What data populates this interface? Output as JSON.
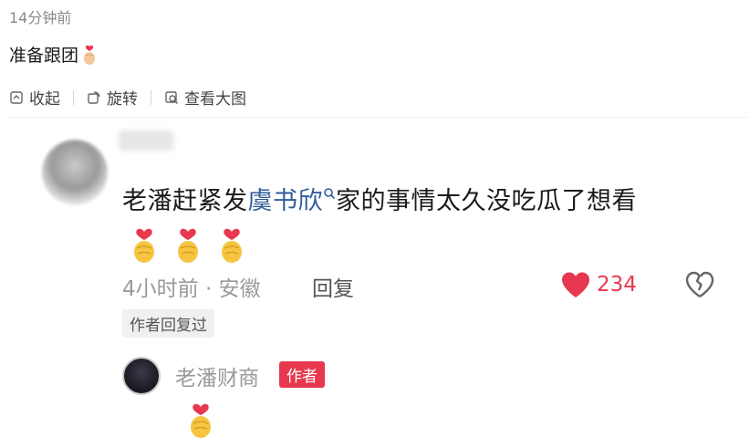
{
  "post": {
    "time": "14分钟前",
    "text": "准备跟团",
    "emoji_icon": "hand-heart-small-icon"
  },
  "actions": [
    {
      "label": "收起",
      "icon": "collapse-icon"
    },
    {
      "label": "旋转",
      "icon": "rotate-icon"
    },
    {
      "label": "查看大图",
      "icon": "view-large-icon"
    }
  ],
  "comment": {
    "text_before": "老潘赶紧发",
    "link": "虞书欣",
    "text_after": "家的事情太久没吃瓜了想看",
    "meta": "4小时前 · 安徽",
    "reply_label": "回复",
    "like_count": "234",
    "author_replied_tag": "作者回复过"
  },
  "reply": {
    "author_name": "老潘财商",
    "author_badge": "作者"
  },
  "colors": {
    "accent_red": "#e8384f",
    "link_blue": "#2f5e9a",
    "meta_gray": "#9a9a9a"
  }
}
